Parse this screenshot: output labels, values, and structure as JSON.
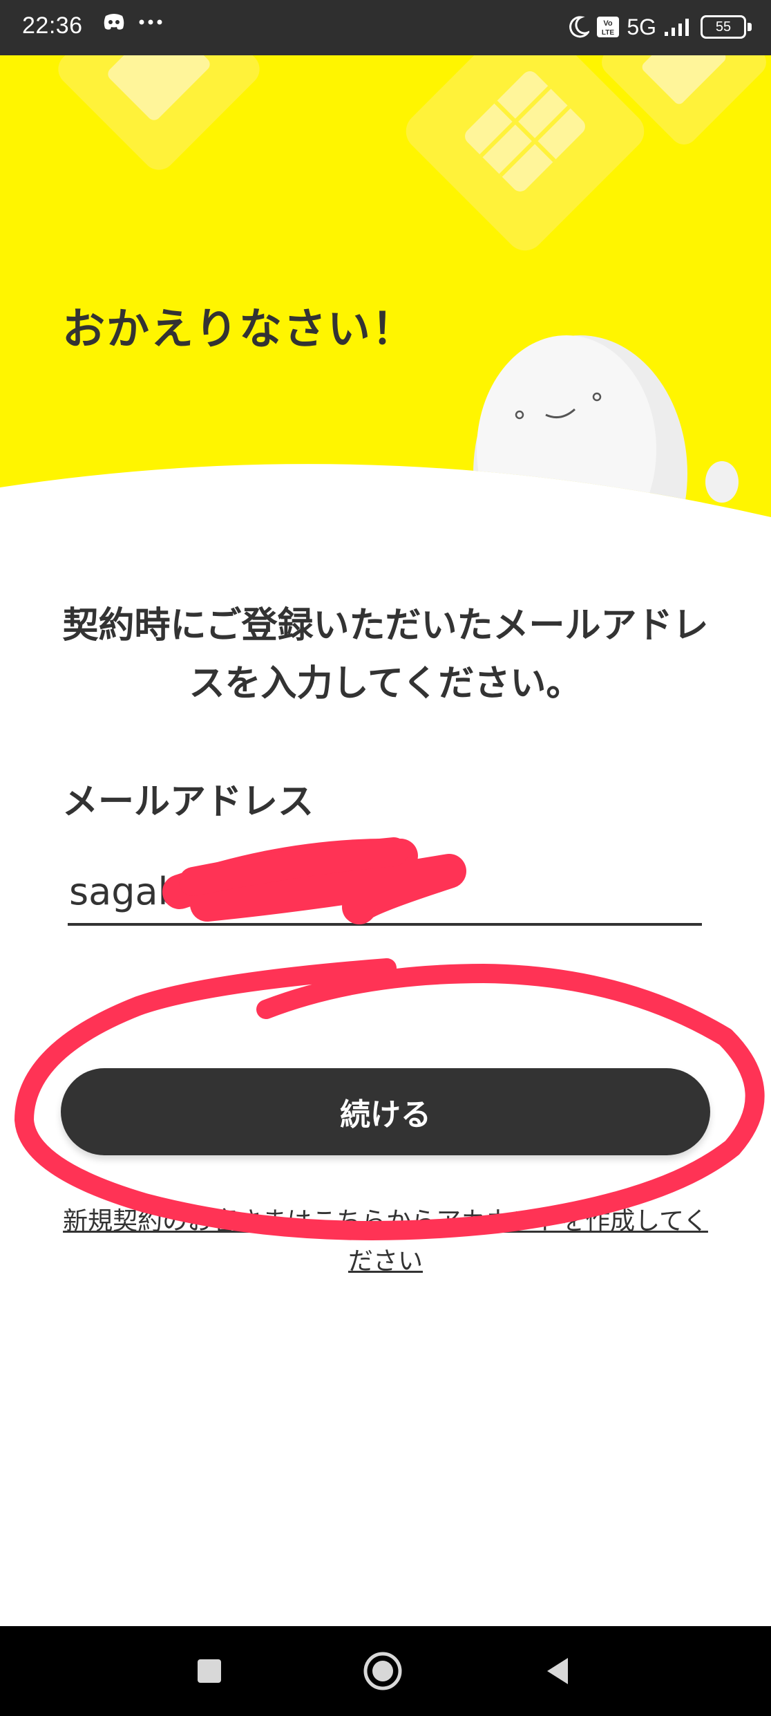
{
  "status_bar": {
    "time": "22:36",
    "left_icons": [
      "discord-icon",
      "more-dots-icon"
    ],
    "network": "5G",
    "volte": "Vo LTE",
    "battery": "55",
    "right_icons": [
      "moon-icon",
      "volte-icon",
      "signal-icon",
      "battery-icon"
    ]
  },
  "hero": {
    "title": "おかえりなさい！",
    "background_color": "#FFF500",
    "decor": [
      "sim-card-icon",
      "mascot-image"
    ]
  },
  "main": {
    "instruction": "契約時にご登録いただいたメールアドレスを入力してください。",
    "email_label": "メールアドレス",
    "email_value": "sagab",
    "continue_label": "続ける",
    "signup_link": "新規契約のお客さまはこちらからアカウントを作成してください"
  },
  "annotation": {
    "color": "#FF3355"
  },
  "nav_bar": {
    "buttons": [
      "recents-button",
      "home-button",
      "back-button"
    ]
  }
}
